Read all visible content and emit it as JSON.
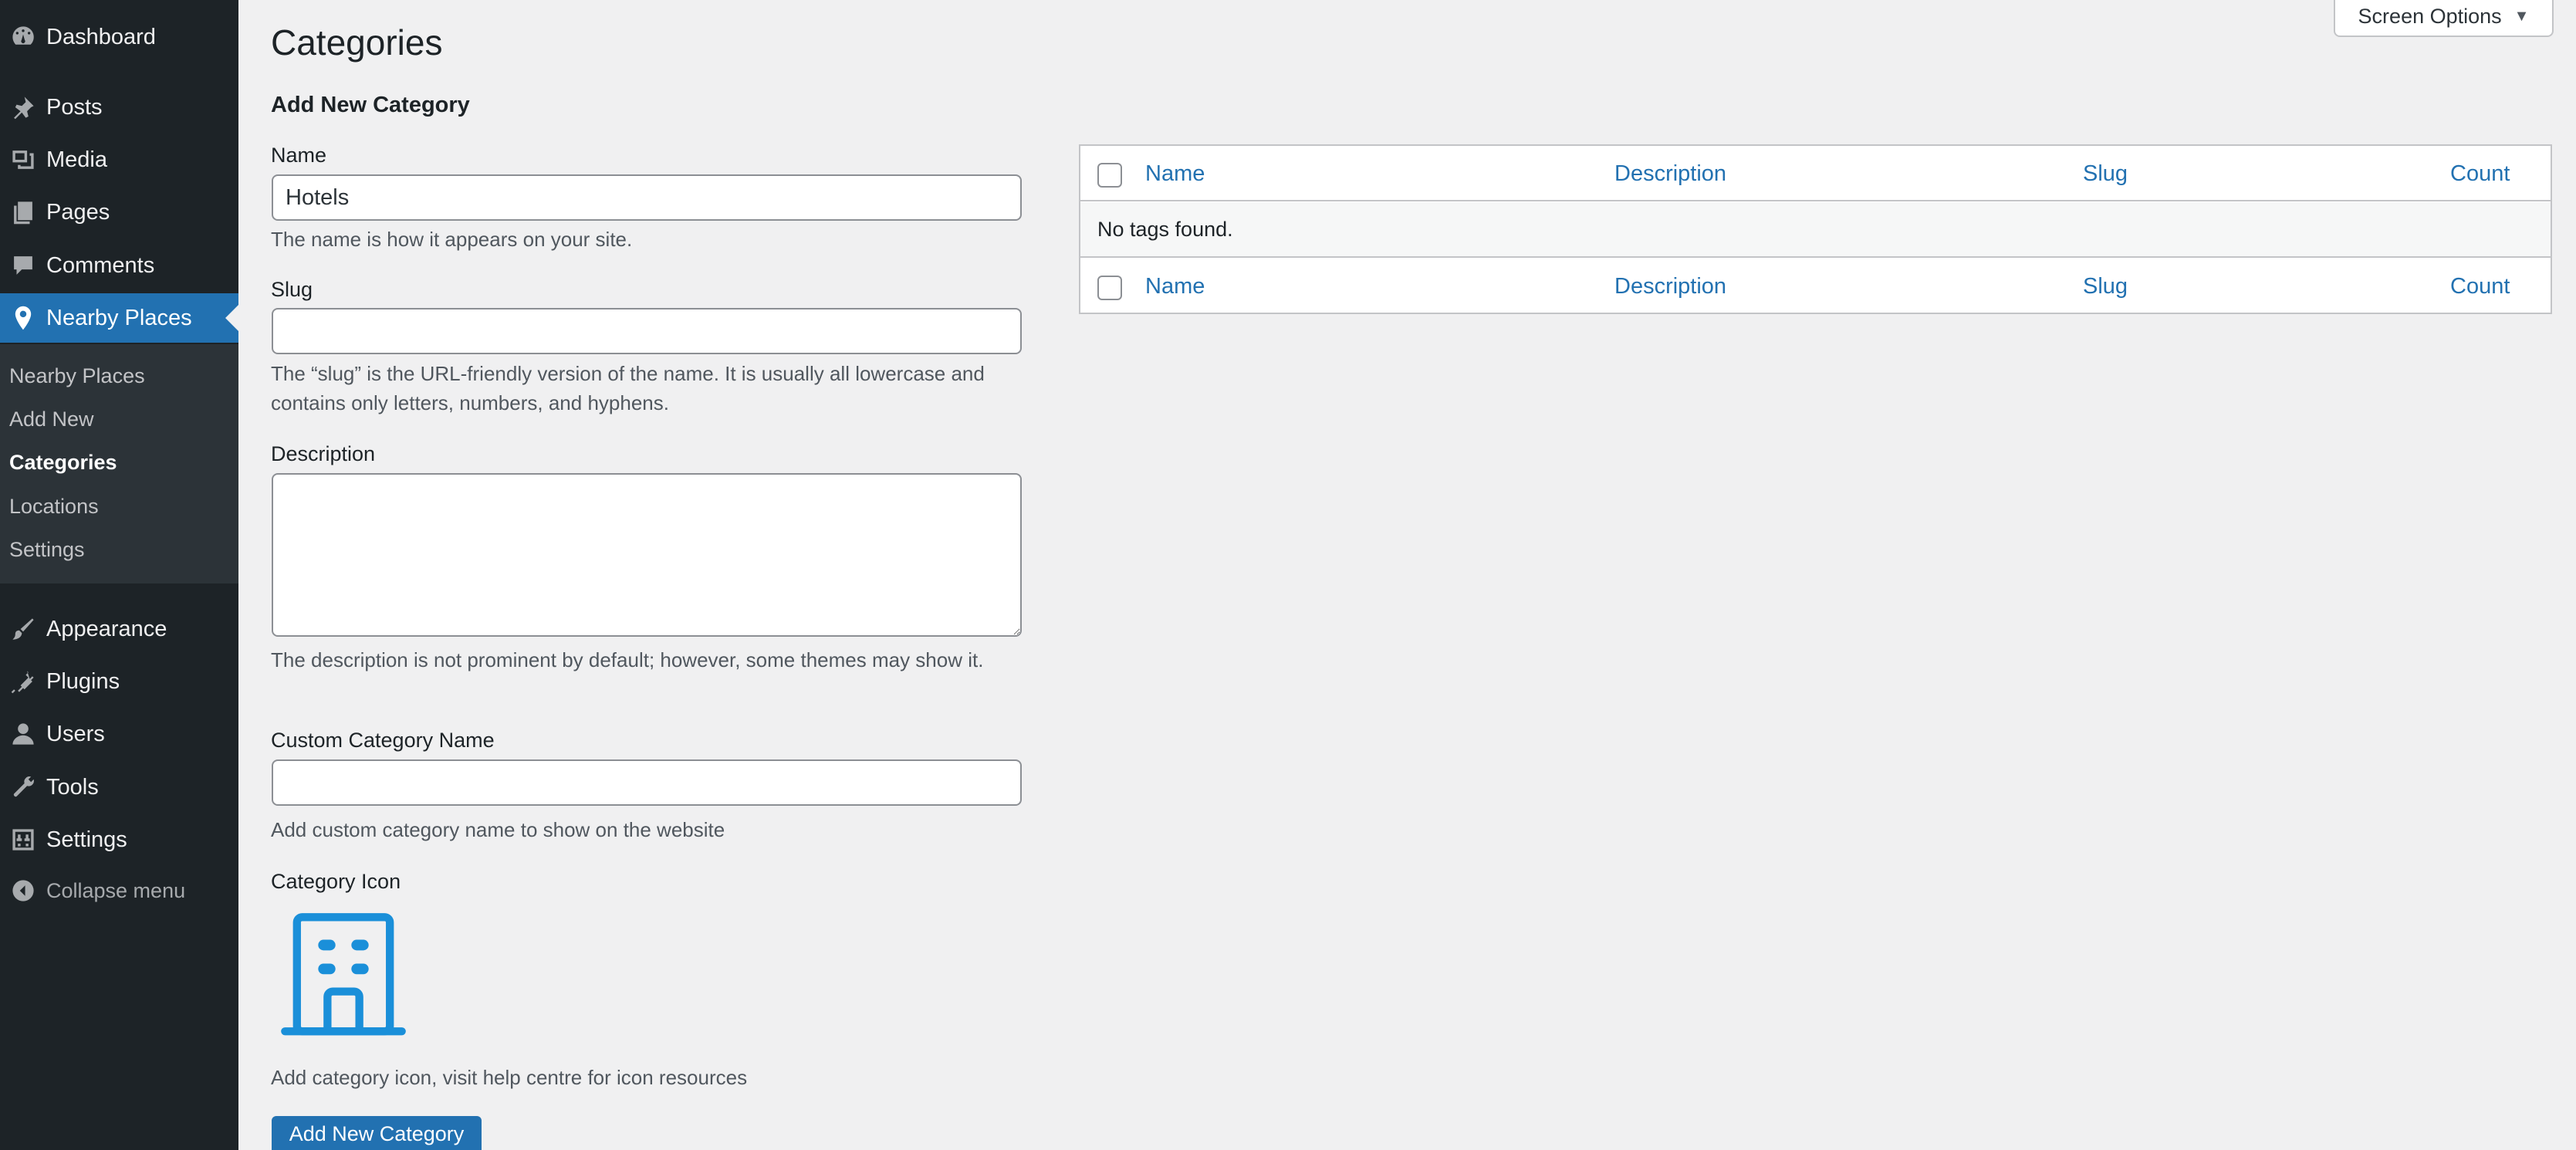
{
  "sidebar": {
    "menu": [
      {
        "label": "Dashboard",
        "icon": "dashboard-icon"
      },
      {
        "label": "Posts",
        "icon": "pushpin-icon"
      },
      {
        "label": "Media",
        "icon": "media-icon"
      },
      {
        "label": "Pages",
        "icon": "pages-icon"
      },
      {
        "label": "Comments",
        "icon": "comments-icon"
      },
      {
        "label": "Nearby Places",
        "icon": "location-pin-icon",
        "active": true
      },
      {
        "label": "Appearance",
        "icon": "paintbrush-icon"
      },
      {
        "label": "Plugins",
        "icon": "plugin-icon"
      },
      {
        "label": "Users",
        "icon": "users-icon"
      },
      {
        "label": "Tools",
        "icon": "wrench-icon"
      },
      {
        "label": "Settings",
        "icon": "settings-icon"
      }
    ],
    "submenu": [
      {
        "label": "Nearby Places"
      },
      {
        "label": "Add New"
      },
      {
        "label": "Categories",
        "current": true
      },
      {
        "label": "Locations"
      },
      {
        "label": "Settings"
      }
    ],
    "collapse_label": "Collapse menu"
  },
  "header": {
    "title": "Categories",
    "screen_options_label": "Screen Options"
  },
  "form": {
    "title": "Add New Category",
    "name": {
      "label": "Name",
      "value": "Hotels",
      "help": "The name is how it appears on your site."
    },
    "slug": {
      "label": "Slug",
      "value": "",
      "help": "The “slug” is the URL-friendly version of the name. It is usually all lowercase and contains only letters, numbers, and hyphens."
    },
    "description": {
      "label": "Description",
      "value": "",
      "help": "The description is not prominent by default; however, some themes may show it."
    },
    "custom_name": {
      "label": "Custom Category Name",
      "value": "",
      "help": "Add custom category name to show on the website"
    },
    "icon": {
      "label": "Category Icon",
      "icon": "building-icon",
      "help": "Add category icon, visit help centre for icon resources"
    },
    "submit_label": "Add New Category"
  },
  "table": {
    "columns": [
      "Name",
      "Description",
      "Slug",
      "Count"
    ],
    "empty_message": "No tags found."
  },
  "colors": {
    "accent": "#2271b1",
    "sidebar_bg": "#1d2327",
    "submenu_bg": "#2c3338",
    "icon_blue": "#1a8fd9"
  }
}
